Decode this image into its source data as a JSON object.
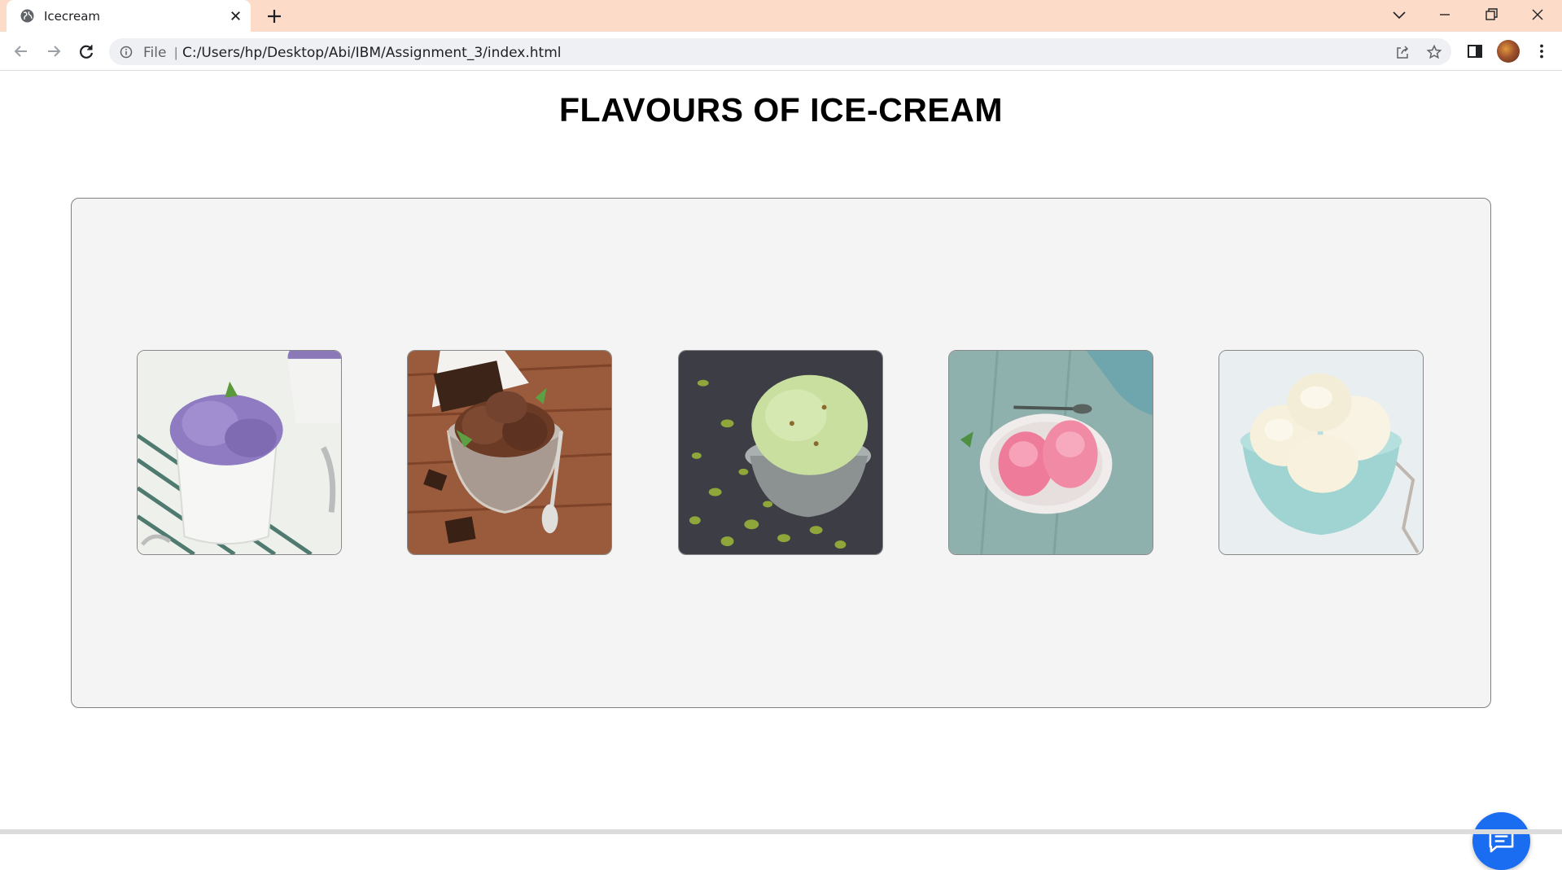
{
  "browser": {
    "tab": {
      "title": "Icecream"
    },
    "address": {
      "scheme_label": "File",
      "separator": "|",
      "url": "C:/Users/hp/Desktop/Abi/IBM/Assignment_3/index.html"
    }
  },
  "page": {
    "title": "FLAVOURS OF ICE-CREAM",
    "flavours": [
      {
        "icon": "blueberry-ice-cream-image"
      },
      {
        "icon": "chocolate-ice-cream-image"
      },
      {
        "icon": "pistachio-ice-cream-image"
      },
      {
        "icon": "strawberry-ice-cream-image"
      },
      {
        "icon": "vanilla-ice-cream-image"
      }
    ]
  },
  "colors": {
    "tabbar": "#fcdcc8",
    "gallery_bg": "#f4f4f4",
    "chat_button": "#1a6cf0"
  }
}
